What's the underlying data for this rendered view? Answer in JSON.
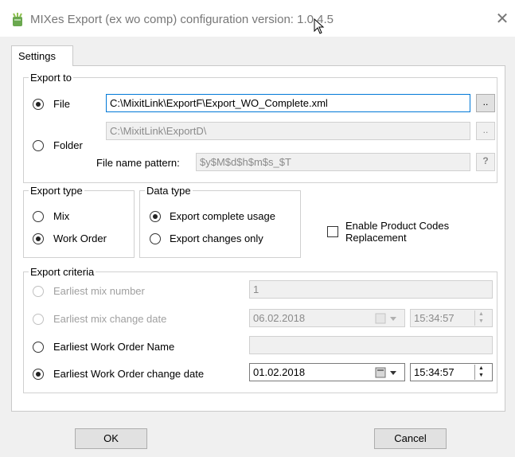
{
  "window": {
    "title": "MIXes Export (ex wo comp) configuration version: 1.0.4.5"
  },
  "tabs": [
    {
      "label": "Settings",
      "active": true
    }
  ],
  "export_to": {
    "group_label": "Export to",
    "file": {
      "label": "File",
      "selected": true,
      "value": "C:\\MixitLink\\ExportF\\Export_WO_Complete.xml",
      "browse_label": ".."
    },
    "folder": {
      "label": "Folder",
      "selected": false,
      "value": "C:\\MixitLink\\ExportD\\",
      "browse_label": ".."
    },
    "pattern": {
      "label": "File name pattern:",
      "value": "$y$M$d$h$m$s_$T",
      "help_label": "?"
    }
  },
  "export_type": {
    "group_label": "Export type",
    "options": [
      {
        "label": "Mix",
        "selected": false
      },
      {
        "label": "Work Order",
        "selected": true
      }
    ]
  },
  "data_type": {
    "group_label": "Data type",
    "options": [
      {
        "label": "Export complete usage",
        "selected": true
      },
      {
        "label": "Export changes only",
        "selected": false
      }
    ]
  },
  "product_codes": {
    "label_line1": "Enable Product Codes",
    "label_line2": "Replacement",
    "checked": false
  },
  "export_criteria": {
    "group_label": "Export criteria",
    "earliest_mix_number": {
      "label": "Earliest mix number",
      "value": "1",
      "enabled": false
    },
    "earliest_mix_change_date": {
      "label": "Earliest mix change date",
      "date": "06.02.2018",
      "time": "15:34:57",
      "enabled": false
    },
    "earliest_wo_name": {
      "label": "Earliest Work Order Name",
      "value": "",
      "enabled": true
    },
    "earliest_wo_change_date": {
      "label": "Earliest Work Order change date",
      "date": "01.02.2018",
      "time": "15:34:57",
      "enabled": true,
      "selected": true
    }
  },
  "buttons": {
    "ok": "OK",
    "cancel": "Cancel"
  },
  "colors": {
    "focus_border": "#0078d7",
    "disabled_text": "#a0a0a0"
  }
}
